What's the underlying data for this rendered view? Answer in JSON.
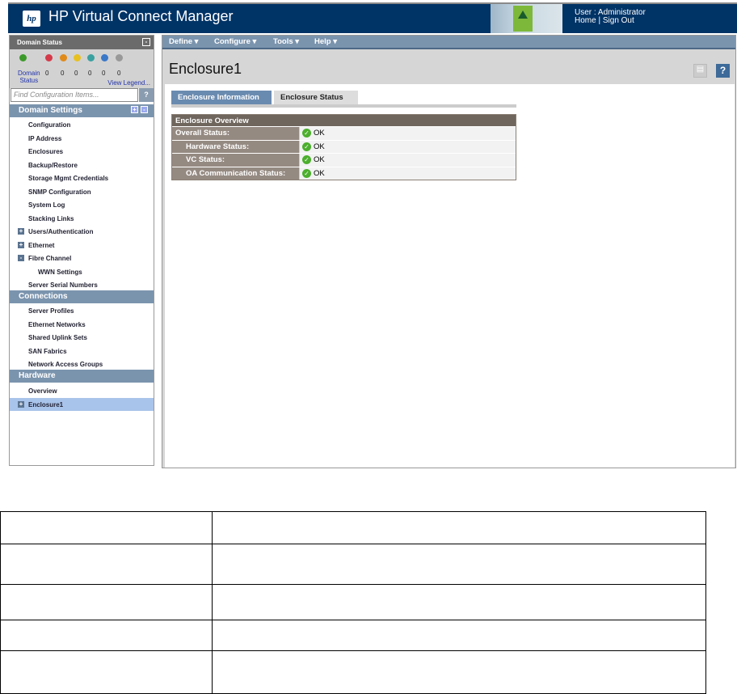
{
  "header": {
    "title": "HP Virtual Connect Manager",
    "logo": "hp",
    "user_label": "User : Administrator",
    "home": "Home",
    "separator": "|",
    "signout": "Sign Out"
  },
  "sidebar": {
    "domain_status": {
      "title": "Domain Status",
      "collapse": "-",
      "label_line1": "Domain",
      "label_line2": "Status",
      "counts": [
        "0",
        "0",
        "0",
        "0",
        "0",
        "0"
      ],
      "view_legend": "View Legend...",
      "icons": [
        {
          "name": "ok-icon",
          "color": "#3c9a2a"
        },
        {
          "name": "critical-icon",
          "color": "#d43a4a"
        },
        {
          "name": "major-icon",
          "color": "#e08a1a"
        },
        {
          "name": "minor-icon",
          "color": "#e8c020"
        },
        {
          "name": "warning-icon",
          "color": "#3aa0a0"
        },
        {
          "name": "info-icon",
          "color": "#3a78c8"
        },
        {
          "name": "unknown-icon",
          "color": "#999999"
        }
      ]
    },
    "search": {
      "placeholder": "Find Configuration Items...",
      "help": "?"
    },
    "sections": {
      "domain_settings": {
        "title": "Domain Settings",
        "expand": "+",
        "collapse": "-",
        "items": [
          "Configuration",
          "IP Address",
          "Enclosures",
          "Backup/Restore",
          "Storage Mgmt Credentials",
          "SNMP Configuration",
          "System Log",
          "Stacking Links",
          "Users/Authentication",
          "Ethernet",
          "Fibre Channel",
          "WWN Settings",
          "Server Serial Numbers"
        ]
      },
      "connections": {
        "title": "Connections",
        "items": [
          "Server Profiles",
          "Ethernet Networks",
          "Shared Uplink Sets",
          "SAN Fabrics",
          "Network Access Groups"
        ]
      },
      "hardware": {
        "title": "Hardware",
        "items": [
          "Overview",
          "Enclosure1"
        ]
      }
    },
    "plus": "+",
    "minus": "-"
  },
  "menu": [
    "Define ▾",
    "Configure ▾",
    "Tools ▾",
    "Help ▾"
  ],
  "main": {
    "title": "Enclosure1",
    "help": "?",
    "tabs": [
      "Enclosure Information",
      "Enclosure Status"
    ],
    "overview": {
      "title": "Enclosure Overview",
      "rows": [
        {
          "label": "Overall Status:",
          "value": "OK"
        },
        {
          "label": "Hardware Status:",
          "value": "OK"
        },
        {
          "label": "VC Status:",
          "value": "OK"
        },
        {
          "label": "OA Communication Status:",
          "value": "OK"
        }
      ]
    }
  }
}
